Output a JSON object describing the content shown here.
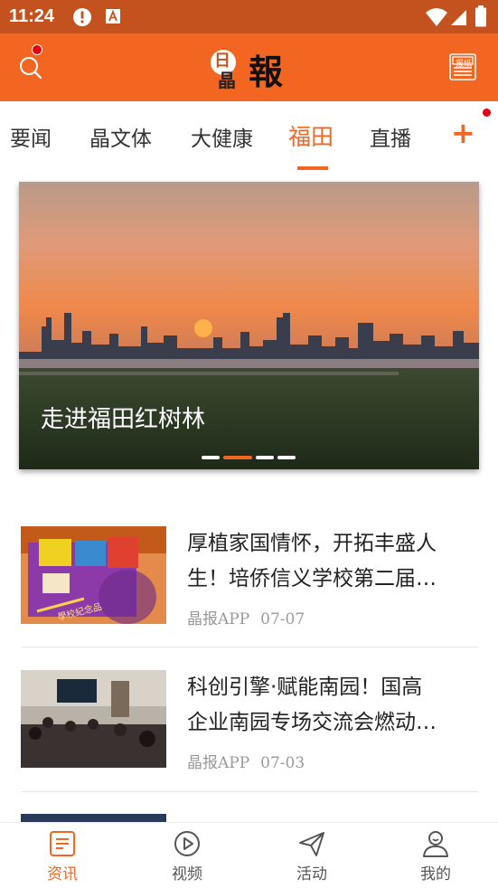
{
  "status_bar": {
    "time": "11:24",
    "icons": [
      "alert-icon",
      "sim-icon",
      "wifi-icon",
      "signal-icon",
      "battery-icon"
    ]
  },
  "header": {
    "logo_main": "報",
    "logo_box": "日",
    "logo_sub": "晶",
    "newspaper_label": "报纸",
    "icons": [
      "search-icon",
      "newspaper-icon"
    ]
  },
  "tabs": [
    {
      "label": "要闻"
    },
    {
      "label": "晶文体"
    },
    {
      "label": "大健康"
    },
    {
      "label": "福田",
      "active": true
    },
    {
      "label": "直播"
    }
  ],
  "add_tab_label": "+",
  "banner": {
    "caption": "走进福田红树林",
    "slide_count": 4,
    "active_slide": 2
  },
  "news": [
    {
      "title_line1": "厚植家国情怀，开拓丰盛人",
      "title_line2": "生！培侨信义学校第二届…",
      "source": "晶报APP",
      "date": "07-07",
      "thumb_text": "學校紀念品"
    },
    {
      "title_line1": "科创引擎·赋能南园！国高",
      "title_line2": "企业南园专场交流会燃动…",
      "source": "晶报APP",
      "date": "07-03"
    }
  ],
  "bottom_nav": [
    {
      "label": "资讯",
      "icon": "news-icon",
      "active": true
    },
    {
      "label": "视频",
      "icon": "video-icon"
    },
    {
      "label": "活动",
      "icon": "paper-plane-icon"
    },
    {
      "label": "我的",
      "icon": "profile-icon"
    }
  ],
  "colors": {
    "brand": "#f36622",
    "status_bar": "#c4521f",
    "notification_dot": "#e60012"
  }
}
